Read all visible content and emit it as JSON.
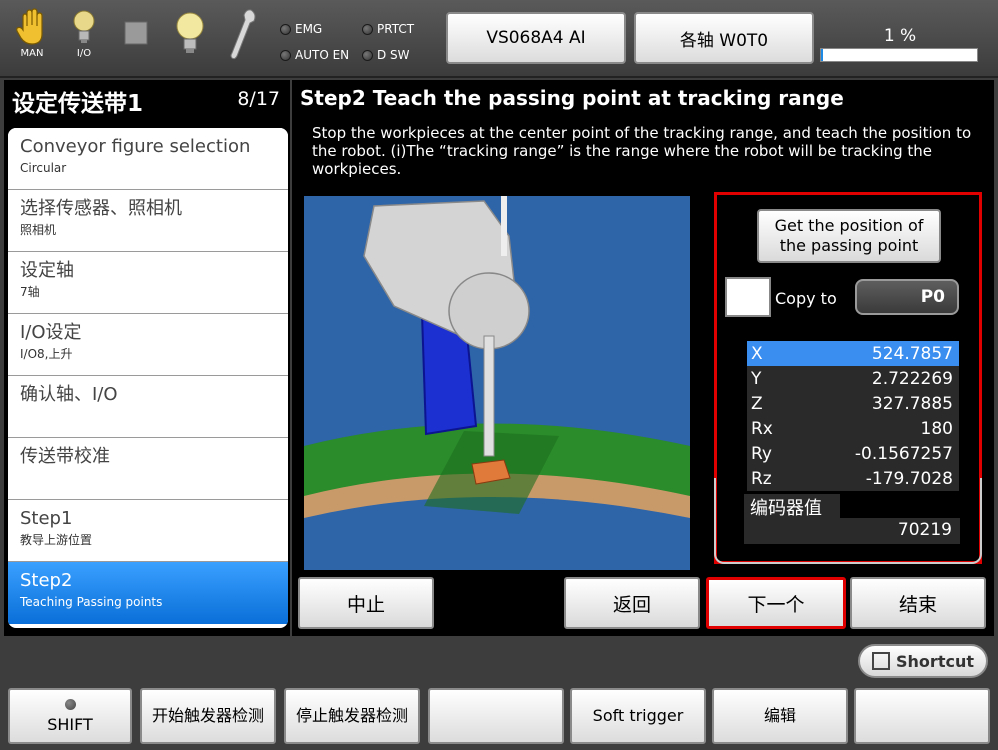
{
  "topbar": {
    "man_label": "MAN",
    "io_label": "I/O",
    "lamps": {
      "emg": "EMG",
      "prtct": "PRTCT",
      "auto_en": "AUTO EN",
      "dsw": "D SW"
    },
    "robot_model": "VS068A4 AI",
    "axis_mode": "各轴 W0T0",
    "speed": "1 %",
    "speed_percent": 1
  },
  "left": {
    "title": "设定传送带1",
    "page": "8/17",
    "steps": [
      {
        "main": "Conveyor figure selection",
        "sub": "Circular"
      },
      {
        "main": "选择传感器、照相机",
        "sub": "照相机"
      },
      {
        "main": "设定轴",
        "sub": "7轴"
      },
      {
        "main": "I/O设定",
        "sub": "I/O8,上升"
      },
      {
        "main": "确认轴、I/O",
        "sub": ""
      },
      {
        "main": "传送带校准",
        "sub": ""
      },
      {
        "main": "Step1",
        "sub": "教导上游位置"
      },
      {
        "main": "Step2",
        "sub": "Teaching Passing points"
      }
    ]
  },
  "main": {
    "title": "Step2 Teach the passing point at tracking range",
    "description": "Stop the workpieces at the center point of the tracking range, and teach the position to the robot. (i)The “tracking range” is the range where the robot will be tracking the workpieces.",
    "get_position_label": "Get the position of the passing point",
    "copy_to_label": "Copy to",
    "copy_target": "P0",
    "coords": [
      {
        "axis": "X",
        "value": "524.7857"
      },
      {
        "axis": "Y",
        "value": "2.722269"
      },
      {
        "axis": "Z",
        "value": "327.7885"
      },
      {
        "axis": "Rx",
        "value": "180"
      },
      {
        "axis": "Ry",
        "value": "-0.1567257"
      },
      {
        "axis": "Rz",
        "value": "-179.7028"
      }
    ],
    "encoder_label": "编码器值",
    "encoder_value": "70219",
    "buttons": {
      "abort": "中止",
      "back": "返回",
      "next": "下一个",
      "finish": "结束"
    }
  },
  "bottom": {
    "shortcut": "Shortcut",
    "shift": "SHIFT",
    "start_trigger": "开始触发器检测",
    "stop_trigger": "停止触发器检测",
    "soft_trigger": "Soft trigger",
    "edit": "编辑"
  },
  "colors": {
    "highlight_red": "#e00000",
    "selected_blue": "#1e88e5",
    "viewport_blue": "#2e64a8"
  }
}
